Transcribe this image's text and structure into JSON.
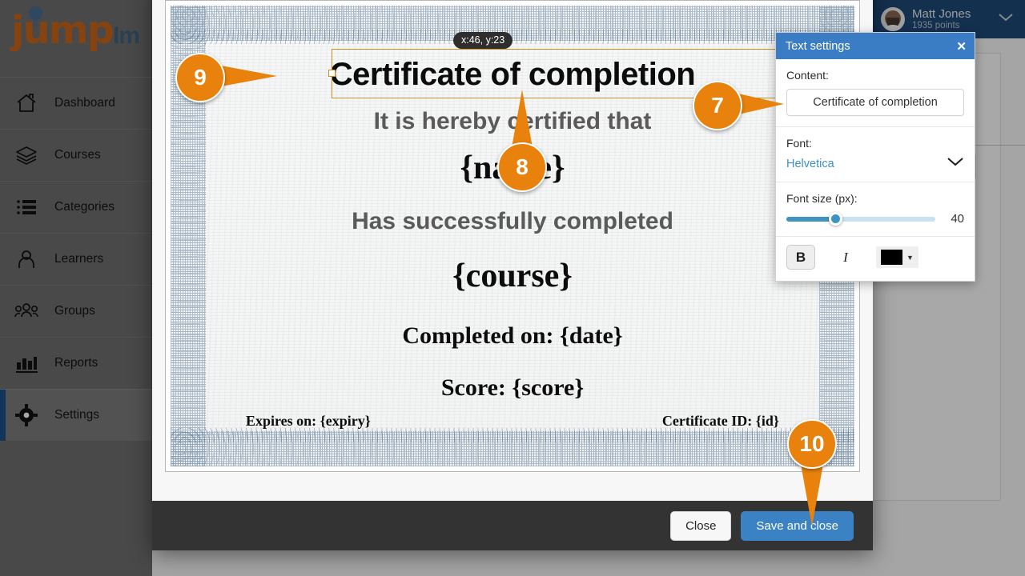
{
  "sidebar": {
    "logo": {
      "main": "jump",
      "suffix": "Im"
    },
    "items": [
      {
        "label": "Dashboard",
        "icon": "home-icon",
        "active": false
      },
      {
        "label": "Courses",
        "icon": "books-icon",
        "active": false
      },
      {
        "label": "Categories",
        "icon": "list-icon",
        "active": false
      },
      {
        "label": "Learners",
        "icon": "user-icon",
        "active": false
      },
      {
        "label": "Groups",
        "icon": "group-icon",
        "active": false
      },
      {
        "label": "Reports",
        "icon": "bar-chart-icon",
        "active": false
      },
      {
        "label": "Settings",
        "icon": "gear-icon",
        "active": true
      }
    ]
  },
  "topbar": {
    "user_name": "Matt Jones",
    "user_points": "1935 points",
    "chevron_icon": "chevron-down-icon",
    "avatar_icon": "avatar"
  },
  "background": {
    "button_glyph": "▤"
  },
  "certificate": {
    "coordinate_tooltip": "x:46, y:23",
    "title": "Certificate of completion",
    "hereby": "It is hereby certified that",
    "name_placeholder": "{name}",
    "has_completed": "Has successfully completed",
    "course_placeholder": "{course}",
    "completed_on": "Completed on: {date}",
    "score": "Score: {score}",
    "expires_on": "Expires on: {expiry}",
    "certificate_id": "Certificate ID: {id}"
  },
  "modal_footer": {
    "close_label": "Close",
    "save_label": "Save and close"
  },
  "text_settings": {
    "title": "Text settings",
    "close_icon": "close-icon",
    "content_label": "Content:",
    "content_value": "Certificate of completion",
    "font_label": "Font:",
    "font_value": "Helvetica",
    "font_chevron_icon": "chevron-down-icon",
    "font_size_label": "Font size (px):",
    "font_size_value": "40",
    "bold_label": "B",
    "italic_label": "I",
    "color_value": "#000000",
    "color_caret_icon": "caret-down-icon"
  },
  "callouts": [
    {
      "number": "9",
      "points_to": "selection-handle-left"
    },
    {
      "number": "7",
      "points_to": "content-input"
    },
    {
      "number": "8",
      "points_to": "certificate-title"
    },
    {
      "number": "10",
      "points_to": "save-and-close-button"
    }
  ],
  "colors": {
    "accent_orange": "#e8820c",
    "brand_orange": "#c8661a",
    "brand_blue": "#41617f",
    "panel_blue": "#3b7dc4",
    "save_blue": "#3b82c4",
    "topbar_blue": "#1f4a78",
    "sidebar_gray": "#6f6f6f",
    "footer_dark": "#333333",
    "selection_gold": "#c9901f"
  }
}
